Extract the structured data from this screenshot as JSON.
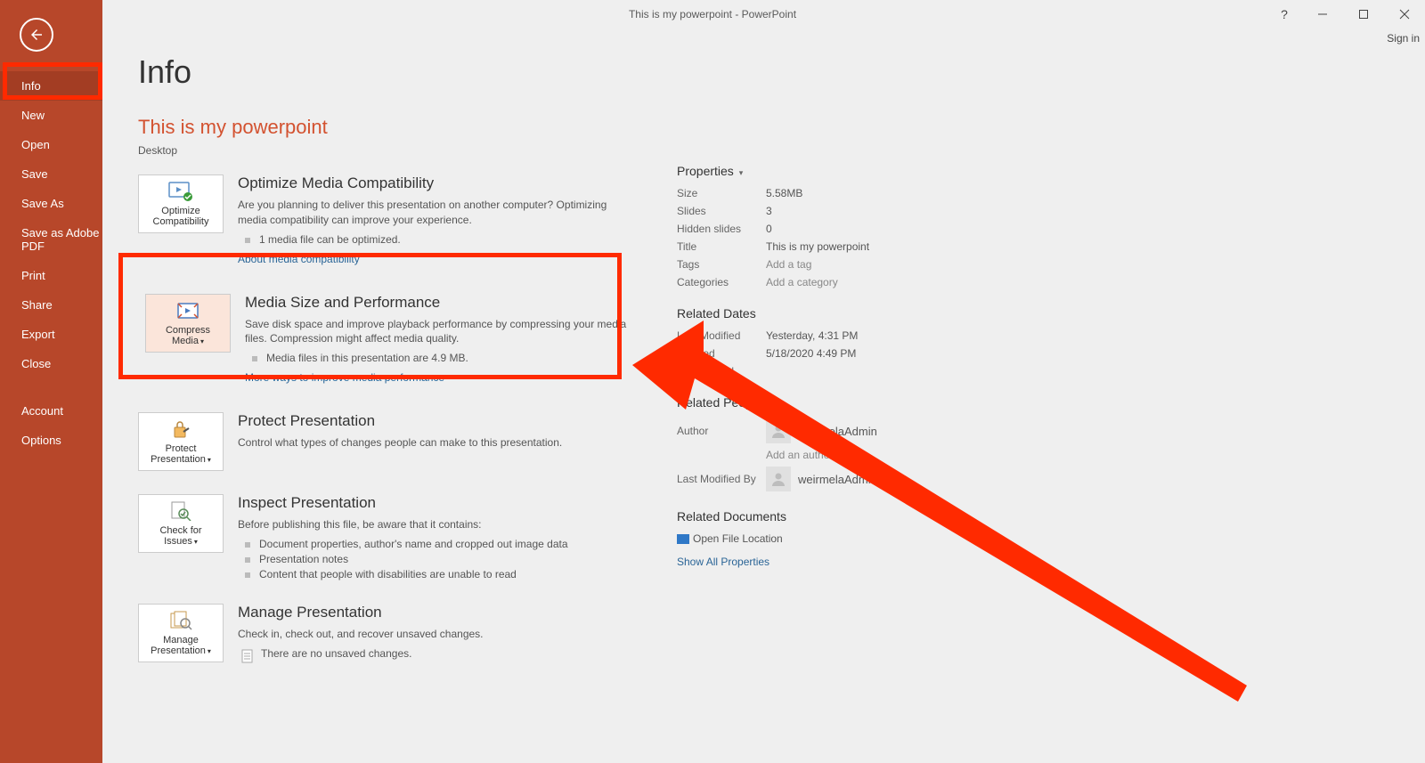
{
  "window": {
    "title": "This is my powerpoint - PowerPoint",
    "sign_in": "Sign in"
  },
  "nav": {
    "info": "Info",
    "new": "New",
    "open": "Open",
    "save": "Save",
    "save_as": "Save As",
    "save_adobe": "Save as Adobe PDF",
    "print": "Print",
    "share": "Share",
    "export": "Export",
    "close": "Close",
    "account": "Account",
    "options": "Options"
  },
  "page": {
    "title": "Info",
    "filename": "This is my powerpoint",
    "location": "Desktop"
  },
  "optimize": {
    "btn": "Optimize Compatibility",
    "heading": "Optimize Media Compatibility",
    "desc": "Are you planning to deliver this presentation on another computer? Optimizing media compatibility can improve your experience.",
    "bullet": "1 media file can be optimized.",
    "link": "About media compatibility"
  },
  "compress": {
    "btn": "Compress Media",
    "heading": "Media Size and Performance",
    "desc": "Save disk space and improve playback performance by compressing your media files. Compression might affect media quality.",
    "bullet": "Media files in this presentation are 4.9 MB.",
    "link": "More ways to improve media performance"
  },
  "protect": {
    "btn": "Protect Presentation",
    "heading": "Protect Presentation",
    "desc": "Control what types of changes people can make to this presentation."
  },
  "inspect": {
    "btn": "Check for Issues",
    "heading": "Inspect Presentation",
    "desc": "Before publishing this file, be aware that it contains:",
    "b1": "Document properties, author's name and cropped out image data",
    "b2": "Presentation notes",
    "b3": "Content that people with disabilities are unable to read"
  },
  "manage": {
    "btn": "Manage Presentation",
    "heading": "Manage Presentation",
    "desc": "Check in, check out, and recover unsaved changes.",
    "b1": "There are no unsaved changes."
  },
  "props": {
    "header": "Properties",
    "size_l": "Size",
    "size_v": "5.58MB",
    "slides_l": "Slides",
    "slides_v": "3",
    "hidden_l": "Hidden slides",
    "hidden_v": "0",
    "title_l": "Title",
    "title_v": "This is my powerpoint",
    "tags_l": "Tags",
    "tags_v": "Add a tag",
    "cat_l": "Categories",
    "cat_v": "Add a category",
    "related_dates": "Related Dates",
    "lm_l": "Last Modified",
    "lm_v": "Yesterday, 4:31 PM",
    "cr_l": "Created",
    "cr_v": "5/18/2020 4:49 PM",
    "lp_l": "Last Printed",
    "related_people": "Related People",
    "author_l": "Author",
    "author_v": "weirmelaAdmin",
    "add_author": "Add an author",
    "lmb_l": "Last Modified By",
    "lmb_v": "weirmelaAdmin",
    "related_docs": "Related Documents",
    "open_loc": "Open File Location",
    "show_all": "Show All Properties"
  }
}
